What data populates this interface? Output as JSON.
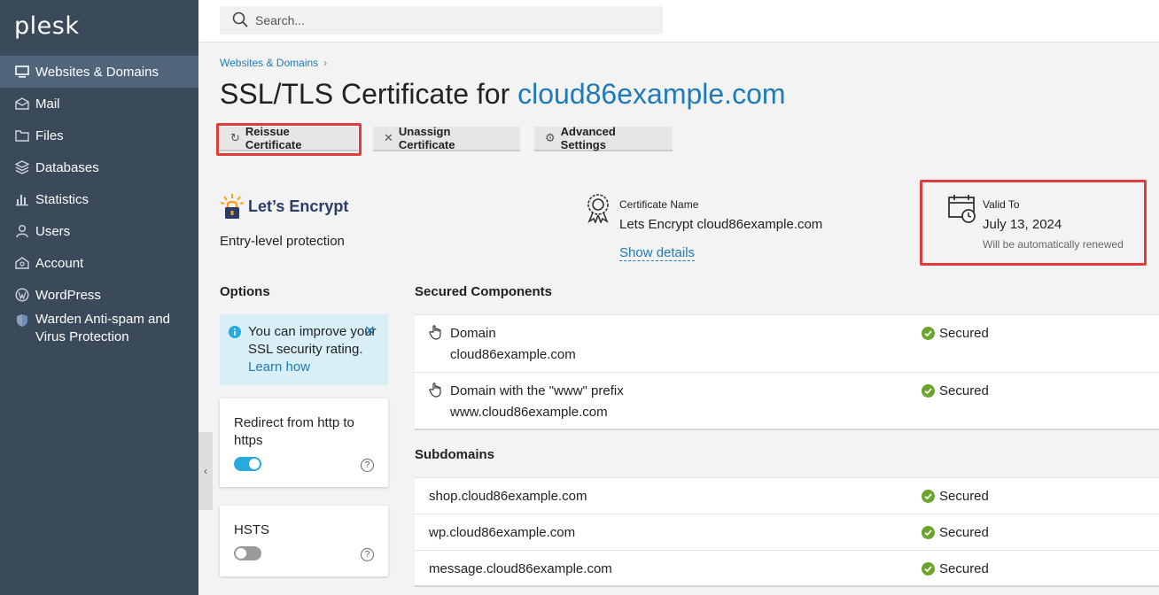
{
  "brand": {
    "logo_text": "plesk"
  },
  "sidebar": {
    "items": [
      {
        "label": "Websites & Domains",
        "icon": "monitor-icon"
      },
      {
        "label": "Mail",
        "icon": "mail-icon"
      },
      {
        "label": "Files",
        "icon": "folder-icon"
      },
      {
        "label": "Databases",
        "icon": "database-icon"
      },
      {
        "label": "Statistics",
        "icon": "bar-chart-icon"
      },
      {
        "label": "Users",
        "icon": "user-icon"
      },
      {
        "label": "Account",
        "icon": "account-icon"
      },
      {
        "label": "WordPress",
        "icon": "wordpress-icon"
      },
      {
        "label": "Warden Anti-spam and Virus Protection",
        "icon": "shield-icon"
      }
    ],
    "active": "Websites & Domains"
  },
  "search": {
    "placeholder": "Search..."
  },
  "breadcrumb": {
    "link": "Websites & Domains",
    "separator": "›"
  },
  "page": {
    "title_prefix": "SSL/TLS Certificate for",
    "title_domain": "cloud86example.com"
  },
  "toolbar": {
    "reissue_label": "Reissue Certificate",
    "unassign_label": "Unassign Certificate",
    "advanced_label": "Advanced Settings"
  },
  "certificate": {
    "issuer_logo_text": "Let’s Encrypt",
    "protection_level": "Entry-level protection",
    "name_label": "Certificate Name",
    "name_value": "Lets Encrypt cloud86example.com",
    "show_details": "Show details",
    "valid_label": "Valid To",
    "valid_date": "July 13, 2024",
    "valid_note": "Will be automatically renewed"
  },
  "options": {
    "title": "Options",
    "info_text": "You can improve your SSL security rating.",
    "info_link": "Learn how",
    "redirect_label": "Redirect from http to https",
    "redirect_on": true,
    "hsts_label": "HSTS",
    "hsts_on": false,
    "help_glyph": "?"
  },
  "secured_components": {
    "title": "Secured Components",
    "rows": [
      {
        "type": "Domain",
        "value": "cloud86example.com",
        "status": "Secured"
      },
      {
        "type": "Domain with the \"www\" prefix",
        "value": "www.cloud86example.com",
        "status": "Secured"
      }
    ]
  },
  "subdomains": {
    "title": "Subdomains",
    "rows": [
      {
        "value": "shop.cloud86example.com",
        "status": "Secured"
      },
      {
        "value": "wp.cloud86example.com",
        "status": "Secured"
      },
      {
        "value": "message.cloud86example.com",
        "status": "Secured"
      }
    ]
  },
  "colors": {
    "accent": "#1e7ab8",
    "sidebar": "#3b4a5a",
    "highlight": "#e03c3c",
    "success": "#6aa52a"
  }
}
